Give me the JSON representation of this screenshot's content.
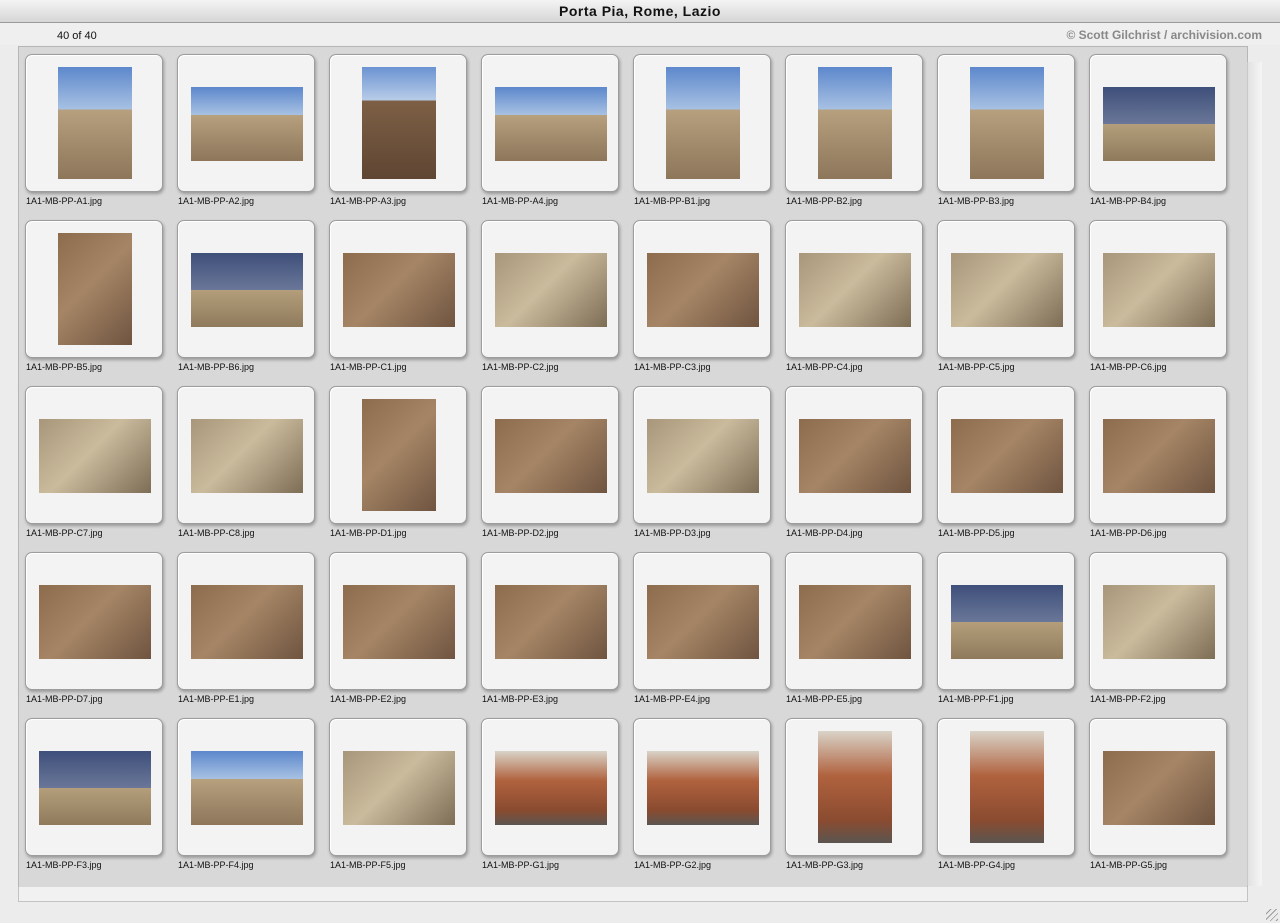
{
  "window": {
    "title": "Porta Pia, Rome, Lazio"
  },
  "status": {
    "count": "40 of 40",
    "credit": "© Scott Gilchrist / archivision.com"
  },
  "colors": {
    "sky": "#3f6fb8",
    "stone": "#b39a76",
    "brick": "#8b6a4a",
    "label_text": "#111111",
    "credit_text": "#888888"
  },
  "thumbnails": [
    {
      "file": "1A1-MB-PP-A1.jpg",
      "orientation": "portrait",
      "palette": "sky-stone"
    },
    {
      "file": "1A1-MB-PP-A2.jpg",
      "orientation": "landscape",
      "palette": "sky-stone"
    },
    {
      "file": "1A1-MB-PP-A3.jpg",
      "orientation": "portrait",
      "palette": "sky-brick"
    },
    {
      "file": "1A1-MB-PP-A4.jpg",
      "orientation": "landscape",
      "palette": "sky-stone"
    },
    {
      "file": "1A1-MB-PP-B1.jpg",
      "orientation": "portrait",
      "palette": "sky-stone"
    },
    {
      "file": "1A1-MB-PP-B2.jpg",
      "orientation": "portrait",
      "palette": "sky-stone"
    },
    {
      "file": "1A1-MB-PP-B3.jpg",
      "orientation": "portrait",
      "palette": "sky-stone"
    },
    {
      "file": "1A1-MB-PP-B4.jpg",
      "orientation": "landscape",
      "palette": "dark-sky"
    },
    {
      "file": "1A1-MB-PP-B5.jpg",
      "orientation": "portrait",
      "palette": "brick"
    },
    {
      "file": "1A1-MB-PP-B6.jpg",
      "orientation": "landscape",
      "palette": "dark-sky"
    },
    {
      "file": "1A1-MB-PP-C1.jpg",
      "orientation": "landscape",
      "palette": "brick"
    },
    {
      "file": "1A1-MB-PP-C2.jpg",
      "orientation": "landscape",
      "palette": "stone"
    },
    {
      "file": "1A1-MB-PP-C3.jpg",
      "orientation": "landscape",
      "palette": "brick"
    },
    {
      "file": "1A1-MB-PP-C4.jpg",
      "orientation": "landscape",
      "palette": "stone"
    },
    {
      "file": "1A1-MB-PP-C5.jpg",
      "orientation": "landscape",
      "palette": "stone"
    },
    {
      "file": "1A1-MB-PP-C6.jpg",
      "orientation": "landscape",
      "palette": "stone"
    },
    {
      "file": "1A1-MB-PP-C7.jpg",
      "orientation": "landscape",
      "palette": "stone"
    },
    {
      "file": "1A1-MB-PP-C8.jpg",
      "orientation": "landscape",
      "palette": "stone"
    },
    {
      "file": "1A1-MB-PP-D1.jpg",
      "orientation": "portrait",
      "palette": "brick"
    },
    {
      "file": "1A1-MB-PP-D2.jpg",
      "orientation": "landscape",
      "palette": "brick"
    },
    {
      "file": "1A1-MB-PP-D3.jpg",
      "orientation": "landscape",
      "palette": "stone"
    },
    {
      "file": "1A1-MB-PP-D4.jpg",
      "orientation": "landscape",
      "palette": "brick"
    },
    {
      "file": "1A1-MB-PP-D5.jpg",
      "orientation": "landscape",
      "palette": "brick"
    },
    {
      "file": "1A1-MB-PP-D6.jpg",
      "orientation": "landscape",
      "palette": "brick"
    },
    {
      "file": "1A1-MB-PP-D7.jpg",
      "orientation": "landscape",
      "palette": "brick"
    },
    {
      "file": "1A1-MB-PP-E1.jpg",
      "orientation": "landscape",
      "palette": "brick"
    },
    {
      "file": "1A1-MB-PP-E2.jpg",
      "orientation": "landscape",
      "palette": "brick"
    },
    {
      "file": "1A1-MB-PP-E3.jpg",
      "orientation": "landscape",
      "palette": "brick"
    },
    {
      "file": "1A1-MB-PP-E4.jpg",
      "orientation": "landscape",
      "palette": "brick"
    },
    {
      "file": "1A1-MB-PP-E5.jpg",
      "orientation": "landscape",
      "palette": "brick"
    },
    {
      "file": "1A1-MB-PP-F1.jpg",
      "orientation": "landscape",
      "palette": "dark-sky"
    },
    {
      "file": "1A1-MB-PP-F2.jpg",
      "orientation": "landscape",
      "palette": "stone"
    },
    {
      "file": "1A1-MB-PP-F3.jpg",
      "orientation": "landscape",
      "palette": "dark-sky"
    },
    {
      "file": "1A1-MB-PP-F4.jpg",
      "orientation": "landscape",
      "palette": "sky-stone"
    },
    {
      "file": "1A1-MB-PP-F5.jpg",
      "orientation": "landscape",
      "palette": "stone"
    },
    {
      "file": "1A1-MB-PP-G1.jpg",
      "orientation": "landscape",
      "palette": "street"
    },
    {
      "file": "1A1-MB-PP-G2.jpg",
      "orientation": "landscape",
      "palette": "street"
    },
    {
      "file": "1A1-MB-PP-G3.jpg",
      "orientation": "portrait",
      "palette": "street"
    },
    {
      "file": "1A1-MB-PP-G4.jpg",
      "orientation": "portrait",
      "palette": "street"
    },
    {
      "file": "1A1-MB-PP-G5.jpg",
      "orientation": "landscape",
      "palette": "brick"
    }
  ]
}
